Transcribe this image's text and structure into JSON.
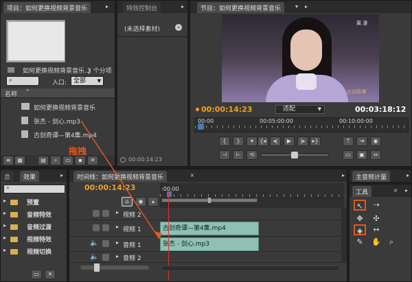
{
  "project": {
    "tab_title": "项目：如何更换视频背景音乐",
    "item_name": "如何更换视频背景音乐..j",
    "item_count": "3 个分项",
    "entry_label": "入口:",
    "entry_value": "全部",
    "col_name": "名称",
    "items": [
      "如何更换视频背景音乐",
      "张杰 - 剑心.mp3",
      "古剑奇谭—第4集.mp4"
    ]
  },
  "effect_controls": {
    "tab_title": "特效控制台",
    "no_clip": "(未选择素材)",
    "timecode": "00:00:14:23"
  },
  "program": {
    "tab_title": "节目：如何更换视频背景音乐",
    "current_time": "00:00:14:23",
    "fit_label": "适配",
    "duration": "00:03:18:12",
    "ruler": [
      "00:00",
      "00:05:00:00",
      "00:10:00:00"
    ],
    "video_caption_top": "离 凄",
    "video_caption_bottom": "古剑奇谭"
  },
  "annotation": {
    "drag_label": "拖拽"
  },
  "effects": {
    "tab_info": "息",
    "tab_title": "效果",
    "items": [
      "预置",
      "音频特效",
      "音频过渡",
      "视频特效",
      "视频切换"
    ]
  },
  "timeline": {
    "tab_title": "时间线：如何更换视频背景音乐",
    "timecode": "00:00:14:23",
    "ruler_start": ":00:00",
    "tracks": [
      {
        "name": "视频 2"
      },
      {
        "name": "视频 1",
        "clip": "古剑奇谭—第4集.mp4"
      },
      {
        "name": "音频 1",
        "clip": "张杰 - 剑心.mp3"
      },
      {
        "name": "音频 2"
      }
    ]
  },
  "master": {
    "tab_title": "主音频计量",
    "tools_title": "工具"
  },
  "colors": {
    "accent": "#f0a020",
    "clip": "#8ec0b4",
    "highlight": "#e05a20"
  }
}
